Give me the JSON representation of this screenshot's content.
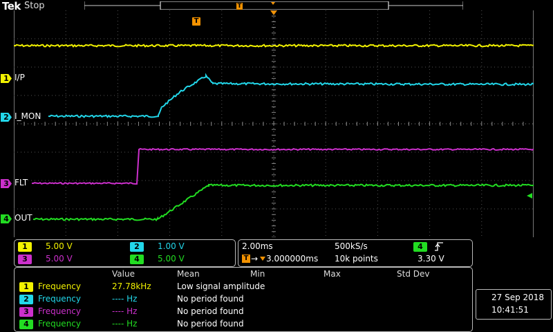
{
  "header": {
    "logo": "Tek",
    "state": "Stop"
  },
  "trigger_marker": "T",
  "screen_trigger_marker": "T",
  "channels": [
    {
      "num": "1",
      "label": "I/P",
      "color": "#f2f200"
    },
    {
      "num": "2",
      "label": "I_MON",
      "color": "#22d7ea"
    },
    {
      "num": "3",
      "label": "FLT",
      "color": "#cc30cc"
    },
    {
      "num": "4",
      "label": "OUT",
      "color": "#22dd22"
    }
  ],
  "scales": [
    {
      "num": "1",
      "value": "5.00 V"
    },
    {
      "num": "2",
      "value": "1.00 V"
    },
    {
      "num": "3",
      "value": "5.00 V"
    },
    {
      "num": "4",
      "value": "5.00 V"
    }
  ],
  "timebase": {
    "horizontal": "2.00ms",
    "sample_rate": "500kS/s",
    "trigger_delay": "3.000000ms",
    "record_length": "10k points",
    "trigger_source": "4",
    "trigger_slope_icon": "rising-edge",
    "trigger_level": "3.30 V"
  },
  "measurements": {
    "headers": [
      "Value",
      "Mean",
      "Min",
      "Max",
      "Std Dev"
    ],
    "rows": [
      {
        "num": "1",
        "label": "Frequency",
        "value": "27.78kHz",
        "note": "Low signal amplitude"
      },
      {
        "num": "2",
        "label": "Frequency",
        "value": "---- Hz",
        "note": "No period found"
      },
      {
        "num": "3",
        "label": "Frequency",
        "value": "---- Hz",
        "note": "No period found"
      },
      {
        "num": "4",
        "label": "Frequency",
        "value": "---- Hz",
        "note": "No period found"
      }
    ]
  },
  "clock": {
    "date": "27 Sep  2018",
    "time": "10:41:51"
  }
}
